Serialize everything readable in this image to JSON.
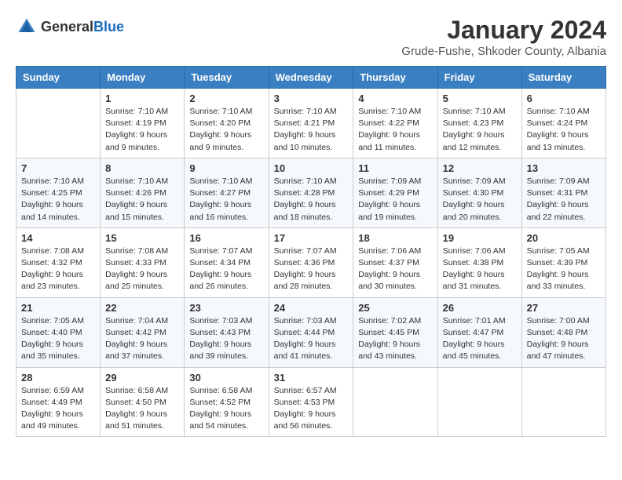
{
  "header": {
    "logo_general": "General",
    "logo_blue": "Blue",
    "month": "January 2024",
    "location": "Grude-Fushe, Shkoder County, Albania"
  },
  "columns": [
    "Sunday",
    "Monday",
    "Tuesday",
    "Wednesday",
    "Thursday",
    "Friday",
    "Saturday"
  ],
  "weeks": [
    [
      {
        "day": "",
        "info": ""
      },
      {
        "day": "1",
        "info": "Sunrise: 7:10 AM\nSunset: 4:19 PM\nDaylight: 9 hours\nand 9 minutes."
      },
      {
        "day": "2",
        "info": "Sunrise: 7:10 AM\nSunset: 4:20 PM\nDaylight: 9 hours\nand 9 minutes."
      },
      {
        "day": "3",
        "info": "Sunrise: 7:10 AM\nSunset: 4:21 PM\nDaylight: 9 hours\nand 10 minutes."
      },
      {
        "day": "4",
        "info": "Sunrise: 7:10 AM\nSunset: 4:22 PM\nDaylight: 9 hours\nand 11 minutes."
      },
      {
        "day": "5",
        "info": "Sunrise: 7:10 AM\nSunset: 4:23 PM\nDaylight: 9 hours\nand 12 minutes."
      },
      {
        "day": "6",
        "info": "Sunrise: 7:10 AM\nSunset: 4:24 PM\nDaylight: 9 hours\nand 13 minutes."
      }
    ],
    [
      {
        "day": "7",
        "info": "Sunrise: 7:10 AM\nSunset: 4:25 PM\nDaylight: 9 hours\nand 14 minutes."
      },
      {
        "day": "8",
        "info": "Sunrise: 7:10 AM\nSunset: 4:26 PM\nDaylight: 9 hours\nand 15 minutes."
      },
      {
        "day": "9",
        "info": "Sunrise: 7:10 AM\nSunset: 4:27 PM\nDaylight: 9 hours\nand 16 minutes."
      },
      {
        "day": "10",
        "info": "Sunrise: 7:10 AM\nSunset: 4:28 PM\nDaylight: 9 hours\nand 18 minutes."
      },
      {
        "day": "11",
        "info": "Sunrise: 7:09 AM\nSunset: 4:29 PM\nDaylight: 9 hours\nand 19 minutes."
      },
      {
        "day": "12",
        "info": "Sunrise: 7:09 AM\nSunset: 4:30 PM\nDaylight: 9 hours\nand 20 minutes."
      },
      {
        "day": "13",
        "info": "Sunrise: 7:09 AM\nSunset: 4:31 PM\nDaylight: 9 hours\nand 22 minutes."
      }
    ],
    [
      {
        "day": "14",
        "info": "Sunrise: 7:08 AM\nSunset: 4:32 PM\nDaylight: 9 hours\nand 23 minutes."
      },
      {
        "day": "15",
        "info": "Sunrise: 7:08 AM\nSunset: 4:33 PM\nDaylight: 9 hours\nand 25 minutes."
      },
      {
        "day": "16",
        "info": "Sunrise: 7:07 AM\nSunset: 4:34 PM\nDaylight: 9 hours\nand 26 minutes."
      },
      {
        "day": "17",
        "info": "Sunrise: 7:07 AM\nSunset: 4:36 PM\nDaylight: 9 hours\nand 28 minutes."
      },
      {
        "day": "18",
        "info": "Sunrise: 7:06 AM\nSunset: 4:37 PM\nDaylight: 9 hours\nand 30 minutes."
      },
      {
        "day": "19",
        "info": "Sunrise: 7:06 AM\nSunset: 4:38 PM\nDaylight: 9 hours\nand 31 minutes."
      },
      {
        "day": "20",
        "info": "Sunrise: 7:05 AM\nSunset: 4:39 PM\nDaylight: 9 hours\nand 33 minutes."
      }
    ],
    [
      {
        "day": "21",
        "info": "Sunrise: 7:05 AM\nSunset: 4:40 PM\nDaylight: 9 hours\nand 35 minutes."
      },
      {
        "day": "22",
        "info": "Sunrise: 7:04 AM\nSunset: 4:42 PM\nDaylight: 9 hours\nand 37 minutes."
      },
      {
        "day": "23",
        "info": "Sunrise: 7:03 AM\nSunset: 4:43 PM\nDaylight: 9 hours\nand 39 minutes."
      },
      {
        "day": "24",
        "info": "Sunrise: 7:03 AM\nSunset: 4:44 PM\nDaylight: 9 hours\nand 41 minutes."
      },
      {
        "day": "25",
        "info": "Sunrise: 7:02 AM\nSunset: 4:45 PM\nDaylight: 9 hours\nand 43 minutes."
      },
      {
        "day": "26",
        "info": "Sunrise: 7:01 AM\nSunset: 4:47 PM\nDaylight: 9 hours\nand 45 minutes."
      },
      {
        "day": "27",
        "info": "Sunrise: 7:00 AM\nSunset: 4:48 PM\nDaylight: 9 hours\nand 47 minutes."
      }
    ],
    [
      {
        "day": "28",
        "info": "Sunrise: 6:59 AM\nSunset: 4:49 PM\nDaylight: 9 hours\nand 49 minutes."
      },
      {
        "day": "29",
        "info": "Sunrise: 6:58 AM\nSunset: 4:50 PM\nDaylight: 9 hours\nand 51 minutes."
      },
      {
        "day": "30",
        "info": "Sunrise: 6:58 AM\nSunset: 4:52 PM\nDaylight: 9 hours\nand 54 minutes."
      },
      {
        "day": "31",
        "info": "Sunrise: 6:57 AM\nSunset: 4:53 PM\nDaylight: 9 hours\nand 56 minutes."
      },
      {
        "day": "",
        "info": ""
      },
      {
        "day": "",
        "info": ""
      },
      {
        "day": "",
        "info": ""
      }
    ]
  ]
}
